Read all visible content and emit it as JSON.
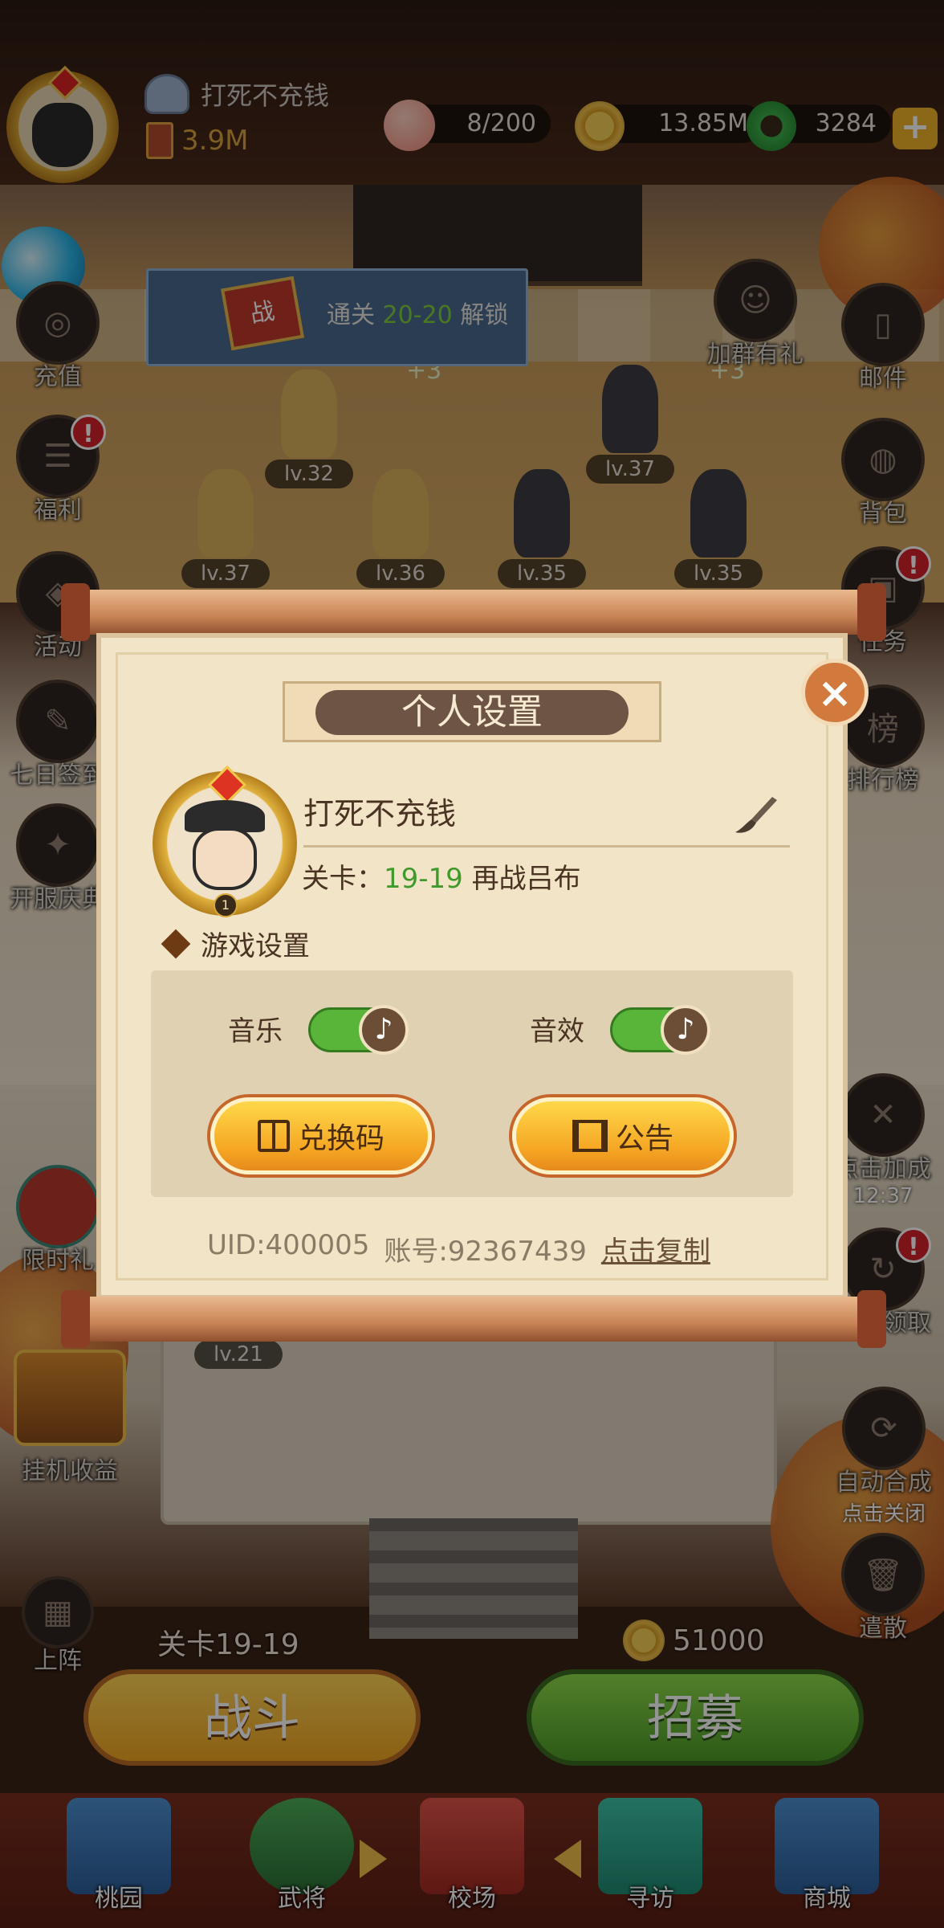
{
  "header": {
    "player_name": "打死不充钱",
    "power": "3.9M",
    "avatar_level": "1",
    "stamina": "8/200",
    "coins": "13.85M",
    "jade": "3284",
    "plus": "+"
  },
  "unlock_banner": {
    "flag": "战",
    "prefix": "通关",
    "stage": "20-20",
    "suffix": "解锁"
  },
  "left_buttons": [
    {
      "label": "充值"
    },
    {
      "label": "福利",
      "alert": "!"
    },
    {
      "label": "活动"
    },
    {
      "label": "七日签到"
    },
    {
      "label": "开服庆典"
    },
    {
      "label": "限时礼"
    },
    {
      "label": "挂机收益"
    },
    {
      "label": "上阵"
    }
  ],
  "right_buttons": [
    {
      "label": "加群有礼"
    },
    {
      "label": "邮件"
    },
    {
      "label": "背包"
    },
    {
      "label": "任务",
      "alert": "!"
    },
    {
      "label": "排行榜",
      "glyph": "榜"
    },
    {
      "label": "点击加成",
      "sub": "12:37"
    },
    {
      "label": "快速领取",
      "alert": "!"
    },
    {
      "label": "自动合成",
      "sub": "点击关闭"
    },
    {
      "label": "遣散"
    }
  ],
  "units": [
    {
      "level": "lv.32"
    },
    {
      "level": "lv.37"
    },
    {
      "level": "lv.37"
    },
    {
      "level": "lv.36"
    },
    {
      "level": "lv.35"
    },
    {
      "level": "lv.35"
    },
    {
      "level": "lv.21"
    }
  ],
  "floating_text": [
    "+3",
    "+3"
  ],
  "dialog": {
    "title": "个人设置",
    "close": "×",
    "player_name": "打死不充钱",
    "avatar_level": "1",
    "stage_label": "关卡：",
    "stage_value": "19-19",
    "stage_name": "再战吕布",
    "section_title": "游戏设置",
    "music_label": "音乐",
    "music_on": true,
    "sfx_label": "音效",
    "sfx_on": true,
    "note_glyph": "♪",
    "redeem_label": "兑换码",
    "notice_label": "公告",
    "uid": "UID:400005",
    "account": "账号:92367439",
    "copy_label": "点击复制"
  },
  "bottom": {
    "stage": "关卡19-19",
    "recruit_cost": "51000",
    "fight_label": "战斗",
    "recruit_label": "招募"
  },
  "nav": [
    {
      "label": "桃园"
    },
    {
      "label": "武将"
    },
    {
      "label": "校场"
    },
    {
      "label": "寻访"
    },
    {
      "label": "商城"
    }
  ],
  "colors": {
    "accent_gold": "#f5a623",
    "toggle_on": "#59b53a",
    "stage_green": "#3f9a2a",
    "alert_red": "#d5222a"
  }
}
